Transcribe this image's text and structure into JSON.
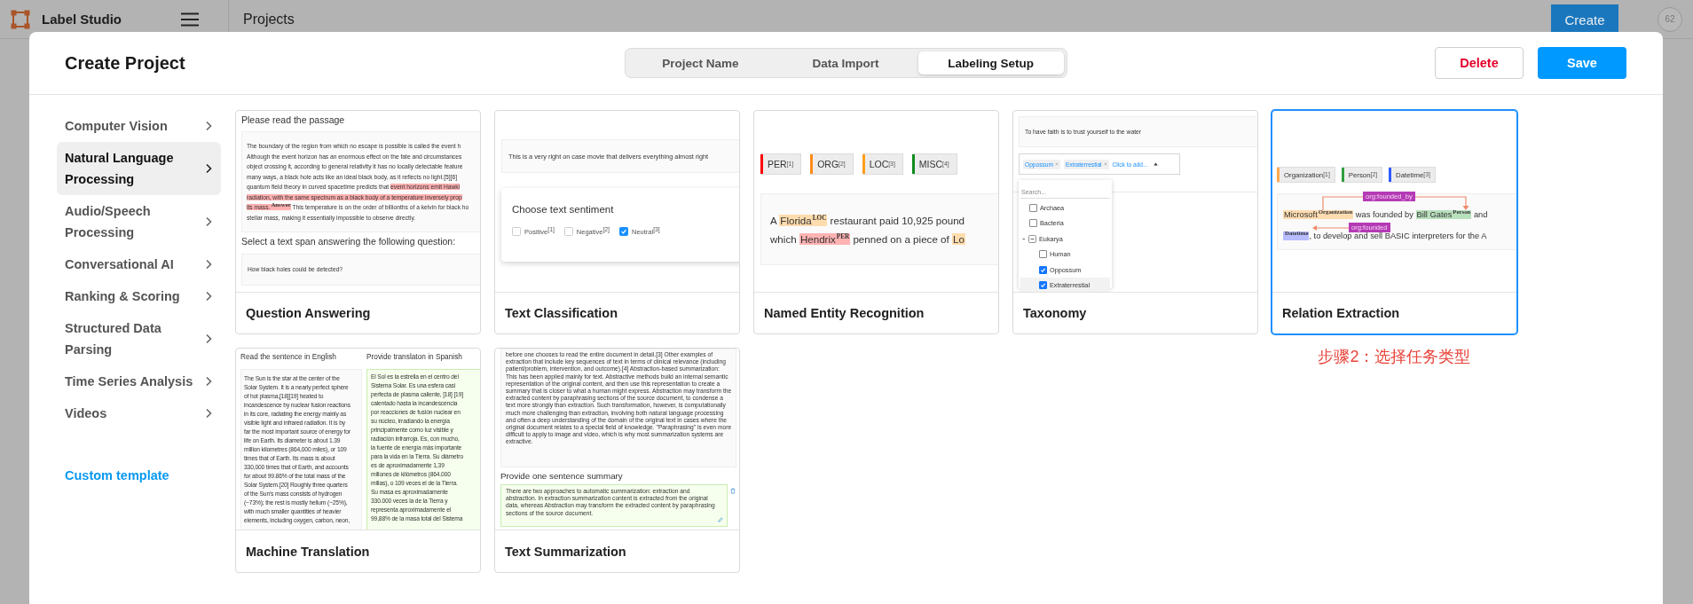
{
  "app_bar": {
    "app_name": "Label Studio",
    "page_title": "Projects",
    "create_button": "Create",
    "avatar": "62"
  },
  "modal": {
    "title": "Create Project",
    "steps": [
      {
        "label": "Project Name",
        "selected": false
      },
      {
        "label": "Data Import",
        "selected": false
      },
      {
        "label": "Labeling Setup",
        "selected": true
      }
    ],
    "delete_button": "Delete",
    "save_button": "Save"
  },
  "sidebar": {
    "items": [
      {
        "label": "Computer Vision",
        "selected": false
      },
      {
        "label": "Natural Language Processing",
        "selected": true
      },
      {
        "label": "Audio/Speech Processing",
        "selected": false
      },
      {
        "label": "Conversational AI",
        "selected": false
      },
      {
        "label": "Ranking & Scoring",
        "selected": false
      },
      {
        "label": "Structured Data Parsing",
        "selected": false
      },
      {
        "label": "Time Series Analysis",
        "selected": false
      },
      {
        "label": "Videos",
        "selected": false
      }
    ],
    "custom_template": "Custom template"
  },
  "templates": [
    {
      "title": "Question Answering",
      "selected": false,
      "preview": {
        "kind": "qa",
        "heading": "Please read the passage",
        "passage": {
          "lines": [
            [
              {
                "text": "The boundary of the region from which no escape is possible is called the event h",
                "highlighted": false
              }
            ],
            [
              {
                "text": "Although the event horizon has an enormous effect on the fate and circumstances",
                "highlighted": false
              }
            ],
            [
              {
                "text": "object crossing it, according to general relativity it has no locally detectable feature",
                "highlighted": false
              }
            ],
            [
              {
                "text": "many ways, a black hole acts like an ideal black body, as it reflects no light.[5][6]",
                "highlighted": false
              }
            ],
            [
              {
                "text": "quantum field theory in curved spacetime predicts that ",
                "highlighted": false
              },
              {
                "text": "event horizons emit Hawki",
                "highlighted": true
              }
            ],
            [
              {
                "text": "radiation, with the same spectrum as a black body of a temperature inversely prop",
                "highlighted": true
              }
            ],
            [
              {
                "text": "its mass.",
                "highlighted": true,
                "label": "Answer"
              },
              {
                "text": " This temperature is on the order of billionths of a kelvin for black ho",
                "highlighted": false
              }
            ],
            [
              {
                "text": "stellar mass, making it essentially impossible to observe directly.",
                "highlighted": false
              }
            ]
          ]
        },
        "question_heading": "Select a text span answering the following question:",
        "question": "How black holes could be detected?"
      }
    },
    {
      "title": "Text Classification",
      "selected": false,
      "preview": {
        "kind": "classification",
        "text": "This is a very right on case movie that delivers everything almost right",
        "prompt": "Choose text sentiment",
        "choices": [
          {
            "label": "Positive",
            "hotkey": "[1]",
            "checked": false
          },
          {
            "label": "Negative",
            "hotkey": "[2]",
            "checked": false
          },
          {
            "label": "Neutral",
            "hotkey": "[3]",
            "checked": true
          }
        ]
      }
    },
    {
      "title": "Named Entity Recognition",
      "selected": false,
      "preview": {
        "kind": "ner",
        "labels": [
          {
            "label": "PER",
            "hotkey": "[1]",
            "color": "#ff0000"
          },
          {
            "label": "ORG",
            "hotkey": "[2]",
            "color": "#ff8c1a"
          },
          {
            "label": "LOC",
            "hotkey": "[3]",
            "color": "#ff9f1a"
          },
          {
            "label": "MISC",
            "hotkey": "[4]",
            "color": "#118a1d"
          }
        ],
        "text": {
          "lines": [
            [
              {
                "text": "A "
              },
              {
                "text": "Florida",
                "label": "LOC",
                "color": "#ffdcae"
              },
              {
                "text": " restaurant paid 10,925 pound"
              }
            ],
            [
              {
                "text": "which "
              },
              {
                "text": "Hendrix",
                "label": "PER",
                "color": "#ffb3b3"
              },
              {
                "text": " penned on a piece of "
              },
              {
                "text": "Lo",
                "color": "#ffdcae"
              }
            ]
          ]
        }
      }
    },
    {
      "title": "Taxonomy",
      "selected": false,
      "preview": {
        "kind": "taxonomy",
        "text": "To have faith is to trust yourself to the water",
        "chips": [
          {
            "label": "Oppossum"
          },
          {
            "label": "Extraterrestial"
          }
        ],
        "add_hint": "Click to add...",
        "search_placeholder": "Search...",
        "tree": [
          {
            "label": "Archaea",
            "checked": false,
            "highlighted": false
          },
          {
            "label": "Bacteria",
            "checked": false,
            "highlighted": false
          },
          {
            "label": "Eukarya",
            "expanded": true,
            "highlighted": false,
            "children": [
              {
                "label": "Human",
                "checked": false,
                "highlighted": false
              },
              {
                "label": "Oppossum",
                "checked": true,
                "highlighted": false
              },
              {
                "label": "Extraterrestial",
                "checked": true,
                "highlighted": true
              }
            ]
          }
        ]
      }
    },
    {
      "title": "Relation Extraction",
      "selected": true,
      "preview": {
        "kind": "relation",
        "labels": [
          {
            "label": "Organization",
            "hotkey": "[1]",
            "color": "#ffa94d"
          },
          {
            "label": "Person",
            "hotkey": "[2]",
            "color": "#2e9e3e"
          },
          {
            "label": "Datetime",
            "hotkey": "[3]",
            "color": "#2f5bff"
          }
        ],
        "text": {
          "lines": [
            [
              {
                "text": "Microsoft",
                "label": "Organization",
                "color": "#ffdcb0"
              },
              {
                "text": " was founded by "
              },
              {
                "text": "Bill Gates",
                "label": "Person",
                "color": "#b9e0bd"
              },
              {
                "text": " and"
              }
            ],
            [
              {
                "label": "Datetime",
                "color": "#b7bcff"
              },
              {
                "text": ", to develop and sell BASIC interpreters for the A"
              }
            ]
          ]
        },
        "relations": [
          {
            "label": "org:founded_by"
          },
          {
            "label": "org:founded"
          }
        ]
      }
    },
    {
      "title": "Machine Translation",
      "selected": false,
      "preview": {
        "kind": "translation",
        "source_heading": "Read the sentence in English",
        "target_heading": "Provide translaton in Spanish",
        "source_lines": [
          "The Sun is the star at the center of the",
          "Solar System. It is a nearly perfect sphere",
          "of hot plasma,[18][19] heated to",
          "incandescence by nuclear fusion reactions",
          "in its core, radiating the energy mainly as",
          "visible light and infrared radiation. It is by",
          "far the most important source of energy for",
          "life on Earth. Its diameter is about 1.39",
          "million kilometres (864,000 miles), or 109",
          "times that of Earth. Its mass is about",
          "330,000 times that of Earth, and accounts",
          "for about 99.86% of the total mass of the",
          "Solar System.[20] Roughly three quarters",
          "of the Sun's mass consists of hydrogen",
          "(~73%); the rest is mostly helium (~25%),",
          "with much smaller quantities of heavier",
          "elements, including oxygen, carbon, neon,"
        ],
        "target_lines": [
          "El Sol es la estrella en el centro del",
          "Sistema Solar. Es una esfera casi",
          "perfecta de plasma caliente, [18] [19]",
          "calentado hasta la incandescencia",
          "por reacciones de fusión nuclear en",
          "su núcleo, irradiando la energía",
          "principalmente como luz visible y",
          "radiación infrarroja. Es, con mucho,",
          "la fuente de energía más importante",
          "para la vida en la Tierra. Su diámetro",
          "es de aproximadamente 1,39",
          "millones de kilómetros (864.000",
          "millas), o 109 veces el de la Tierra.",
          "Su masa es aproximadamente",
          "330.000 veces la de la Tierra y",
          "representa aproximadamente el",
          "99,88% de la masa total del Sistema"
        ]
      }
    },
    {
      "title": "Text Summarization",
      "selected": false,
      "preview": {
        "kind": "summarization",
        "document_text": "before one chooses to read the entire document in detail.[3] Other examples of extraction that include key sequences of text in terms of clinical relevance (including patient/problem, intervention, and outcome).[4] Abstraction-based summarization: This has been applied mainly for text. Abstractive methods build an internal semantic representation of the original content, and then use this representation to create a summary that is closer to what a human might express. Abstraction may transform the extracted content by paraphrasing sections of the source document, to condense a text more strongly than extraction. Such transformation, however, is computationally much more challenging than extraction, involving both natural language processing and often a deep understanding of the domain of the original text in cases where the original document relates to a special field of knowledge. \"Paraphrasing\" is even more difficult to apply to image and video, which is why most summarization systems are extractive.",
        "summary_heading": "Provide one sentence summary",
        "summary_text": "There are two approaches to automatic summarization: extraction and abstraction. In extraction summarization content is extracted from the original data, whereas Abstraction may transform the extracted content by paraphrasing sections of the source document."
      }
    }
  ],
  "annotation": "步骤2：选择任务类型"
}
